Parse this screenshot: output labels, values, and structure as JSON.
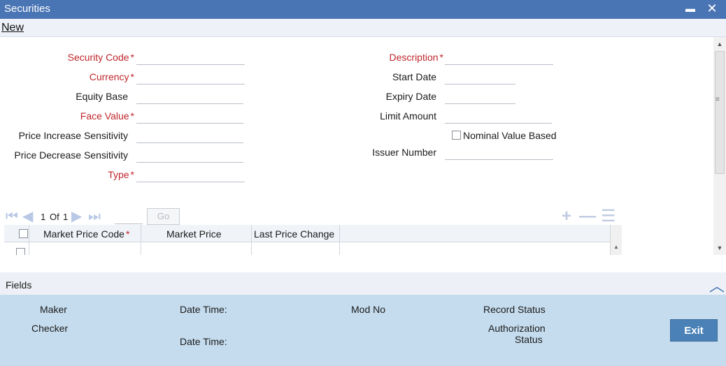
{
  "window": {
    "title": "Securities",
    "minimize_glyph": "▬",
    "close_glyph": "✕"
  },
  "toolbar": {
    "new_label": "New"
  },
  "form": {
    "left": {
      "security_code_label": "Security Code",
      "currency_label": "Currency",
      "equity_base_label": "Equity Base",
      "face_value_label": "Face Value",
      "price_increase_label": "Price Increase Sensitivity",
      "price_decrease_label": "Price Decrease Sensitivity",
      "type_label": "Type"
    },
    "right": {
      "description_label": "Description",
      "start_date_label": "Start Date",
      "expiry_date_label": "Expiry Date",
      "limit_amount_label": "Limit Amount",
      "nominal_value_label": "Nominal Value Based",
      "issuer_number_label": "Issuer Number"
    },
    "required_mark": "*"
  },
  "grid": {
    "pager": {
      "current": "1",
      "of_label": "Of",
      "total": "1",
      "go_label": "Go"
    },
    "columns": [
      "Market Price Code",
      "Market Price",
      "Last Price Change"
    ],
    "required_mark": "*"
  },
  "fields_bar": {
    "label": "Fields"
  },
  "audit": {
    "maker_label": "Maker",
    "checker_label": "Checker",
    "date_time_label": "Date Time:",
    "date_time_label_2": "Date Time:",
    "mod_no_label": "Mod No",
    "record_status_label": "Record Status",
    "authorization_label": "Authorization",
    "status_label": "Status",
    "exit_label": "Exit"
  },
  "colors": {
    "title_bar": "#4a75b5",
    "required": "#c0272d",
    "audit_bg": "#c5dcee",
    "exit_button": "#4a81b6"
  }
}
